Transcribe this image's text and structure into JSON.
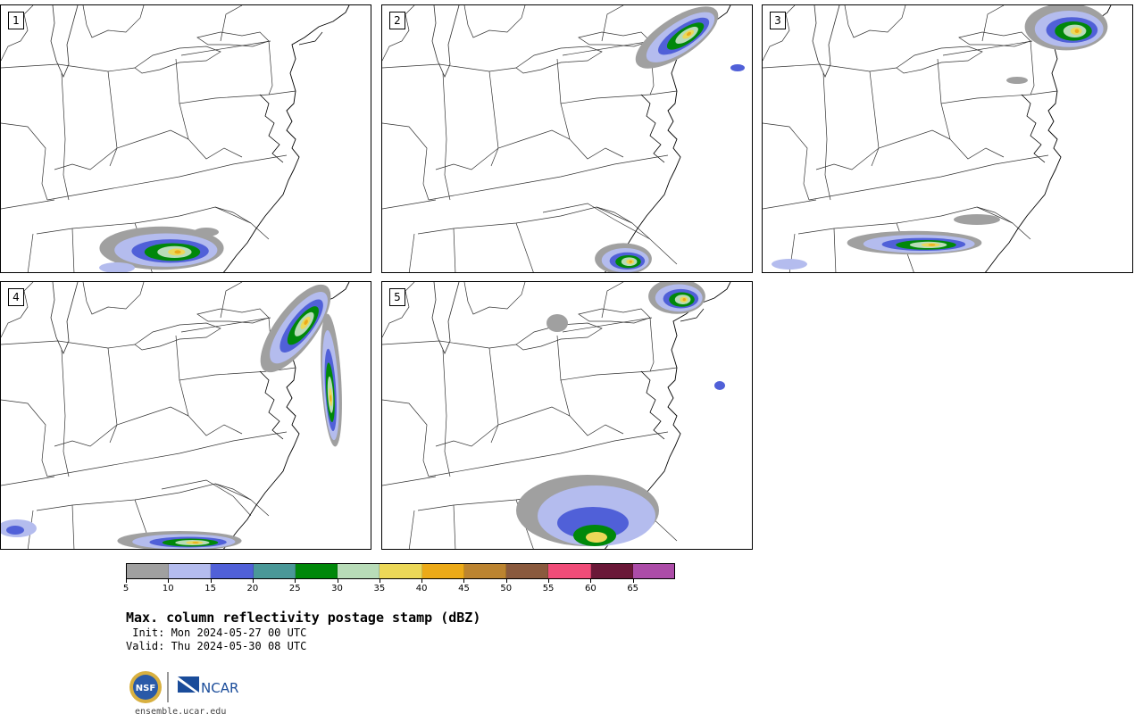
{
  "panels": [
    {
      "label": "1"
    },
    {
      "label": "2"
    },
    {
      "label": "3"
    },
    {
      "label": "4"
    },
    {
      "label": "5"
    }
  ],
  "colorbar": {
    "levels": [
      "5",
      "10",
      "15",
      "20",
      "25",
      "30",
      "35",
      "40",
      "45",
      "50",
      "55",
      "60",
      "65"
    ],
    "colors": [
      "#a0a0a0",
      "#b4bcee",
      "#5060d8",
      "#4a9898",
      "#00880a",
      "#b8dcb8",
      "#ecd858",
      "#ecaa18",
      "#bc8430",
      "#8a5a3e",
      "#f04c78",
      "#6a1838",
      "#ac4ca8"
    ]
  },
  "title": "Max. column reflectivity postage stamp (dBZ)",
  "init": " Init: Mon 2024-05-27 00 UTC",
  "valid": "Valid: Thu 2024-05-30 08 UTC",
  "logos": {
    "nsf": "NSF",
    "ncar": "NCAR"
  },
  "site": "ensemble.ucar.edu"
}
